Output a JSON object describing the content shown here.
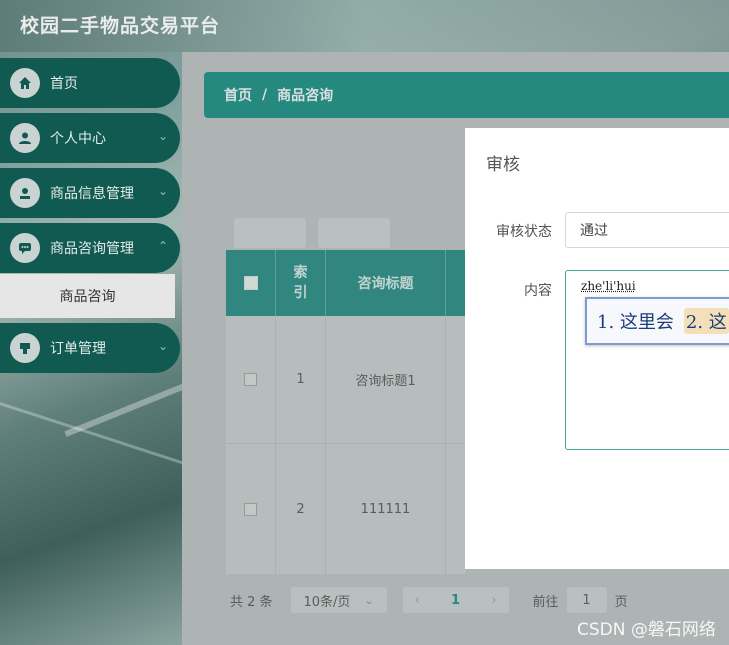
{
  "app": {
    "title": "校园二手物品交易平台"
  },
  "sidebar": {
    "items": [
      {
        "label": "首页",
        "icon": "home-icon",
        "has_submenu": false
      },
      {
        "label": "个人中心",
        "icon": "user-icon",
        "has_submenu": true
      },
      {
        "label": "商品信息管理",
        "icon": "user-badge-icon",
        "has_submenu": true
      },
      {
        "label": "商品咨询管理",
        "icon": "chat-icon",
        "has_submenu": true
      },
      {
        "label": "订单管理",
        "icon": "order-icon",
        "has_submenu": true
      }
    ],
    "submenu": {
      "label": "商品咨询"
    }
  },
  "breadcrumb": {
    "home": "首页",
    "separator": "/",
    "current": "商品咨询"
  },
  "table": {
    "headers": [
      "",
      "索引",
      "咨询标题"
    ],
    "rows": [
      {
        "index": "1",
        "title": "咨询标题1"
      },
      {
        "index": "2",
        "title": "111111"
      }
    ]
  },
  "pagination": {
    "total": "共 2 条",
    "page_size": "10条/页",
    "prev": "‹",
    "current_page": "1",
    "next": "›",
    "goto_label": "前往",
    "goto_value": "1",
    "page_suffix": "页"
  },
  "dialog": {
    "title": "审核",
    "status_label": "审核状态",
    "status_value": "通过",
    "content_label": "内容"
  },
  "ime": {
    "pinyin": "zhe'li'hui",
    "candidate1": "1. 这里会",
    "candidate2": "2. 这"
  },
  "watermark": "CSDN @磐石网络",
  "colors": {
    "accent": "#148b80",
    "sidebar": "#115a52",
    "table_header": "#21897f"
  }
}
